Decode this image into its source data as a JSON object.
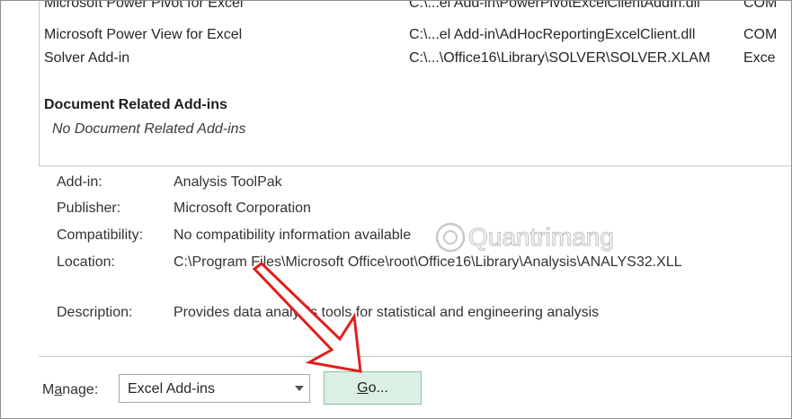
{
  "addins": [
    {
      "name": "Microsoft Power Pivot for Excel",
      "location": "C:\\...el Add-in\\PowerPivotExcelClientAddIn.dll",
      "type": "COM"
    },
    {
      "name": "Microsoft Power View for Excel",
      "location": "C:\\...el Add-in\\AdHocReportingExcelClient.dll",
      "type": "COM"
    },
    {
      "name": "Solver Add-in",
      "location": "C:\\...\\Office16\\Library\\SOLVER\\SOLVER.XLAM",
      "type": "Exce"
    }
  ],
  "document_section": {
    "header": "Document Related Add-ins",
    "empty_text": "No Document Related Add-ins"
  },
  "details": {
    "addin_label": "Add-in:",
    "addin_value": "Analysis ToolPak",
    "publisher_label": "Publisher:",
    "publisher_value": "Microsoft Corporation",
    "compat_label": "Compatibility:",
    "compat_value": "No compatibility information available",
    "location_label": "Location:",
    "location_value": "C:\\Program Files\\Microsoft Office\\root\\Office16\\Library\\Analysis\\ANALYS32.XLL",
    "description_label": "Description:",
    "description_value": "Provides data analysis tools for statistical and engineering analysis"
  },
  "manage": {
    "label_accel": "a",
    "label_pre": "M",
    "label_post": "nage:",
    "selected": "Excel Add-ins"
  },
  "go_button": {
    "accel": "G",
    "rest": "o..."
  },
  "watermark_text": "Quantrimang",
  "colors": {
    "go_bg": "#dcefe4",
    "arrow": "#e0201c"
  }
}
